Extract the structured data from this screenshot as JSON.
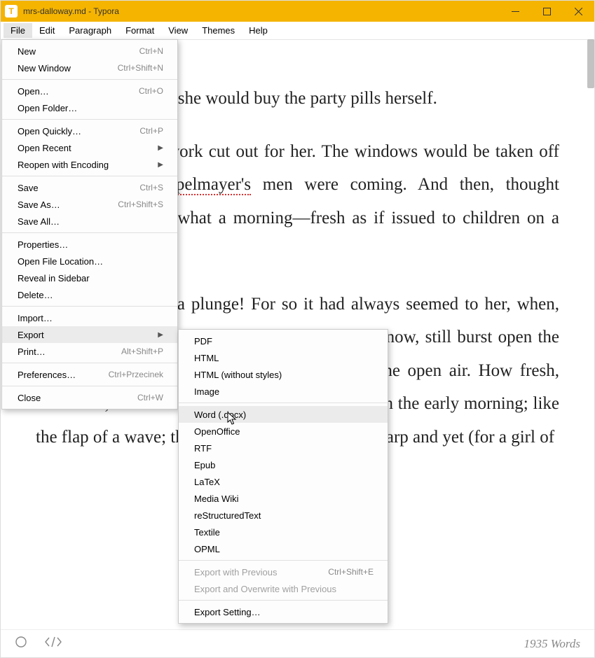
{
  "titlebar": {
    "icon_letter": "T",
    "title": "mrs-dalloway.md - Typora"
  },
  "menubar": {
    "items": [
      "File",
      "Edit",
      "Paragraph",
      "Format",
      "View",
      "Themes",
      "Help"
    ]
  },
  "file_menu": {
    "items": [
      {
        "label": "New",
        "short": "Ctrl+N"
      },
      {
        "label": "New Window",
        "short": "Ctrl+Shift+N"
      },
      {
        "sep": true
      },
      {
        "label": "Open…",
        "short": "Ctrl+O"
      },
      {
        "label": "Open Folder…"
      },
      {
        "sep": true
      },
      {
        "label": "Open Quickly…",
        "short": "Ctrl+P"
      },
      {
        "label": "Open Recent",
        "submenu": true
      },
      {
        "label": "Reopen with Encoding",
        "submenu": true
      },
      {
        "sep": true
      },
      {
        "label": "Save",
        "short": "Ctrl+S"
      },
      {
        "label": "Save As…",
        "short": "Ctrl+Shift+S"
      },
      {
        "label": "Save All…"
      },
      {
        "sep": true
      },
      {
        "label": "Properties…"
      },
      {
        "label": "Open File Location…"
      },
      {
        "label": "Reveal in Sidebar"
      },
      {
        "label": "Delete…"
      },
      {
        "sep": true
      },
      {
        "label": "Import…"
      },
      {
        "label": "Export",
        "submenu": true,
        "highlight": true
      },
      {
        "label": "Print…",
        "short": "Alt+Shift+P"
      },
      {
        "sep": true
      },
      {
        "label": "Preferences…",
        "short": "Ctrl+Przecinek"
      },
      {
        "sep": true
      },
      {
        "label": "Close",
        "short": "Ctrl+W"
      }
    ]
  },
  "export_menu": {
    "items": [
      {
        "label": "PDF"
      },
      {
        "label": "HTML"
      },
      {
        "label": "HTML (without styles)"
      },
      {
        "label": "Image"
      },
      {
        "sep": true
      },
      {
        "label": "Word (.docx)",
        "highlight": true
      },
      {
        "label": "OpenOffice"
      },
      {
        "label": "RTF"
      },
      {
        "label": "Epub"
      },
      {
        "label": "LaTeX"
      },
      {
        "label": "Media Wiki"
      },
      {
        "label": "reStructuredText"
      },
      {
        "label": "Textile"
      },
      {
        "label": "OPML"
      },
      {
        "sep": true
      },
      {
        "label": "Export with Previous",
        "short": "Ctrl+Shift+E",
        "disabled": true
      },
      {
        "label": "Export and Overwrite with Previous",
        "disabled": true
      },
      {
        "sep": true
      },
      {
        "label": "Export Setting…"
      }
    ]
  },
  "document": {
    "p1a": "Mrs. Dalloway said she would buy the party pills herself.",
    "p2a": "For Lucy had her work cut out for her. The windows would be taken off their hinges; ",
    "p2b": "Rumpelmayer's",
    "p2c": " men were coming. And then, thought Clarissa Dalloway, what a morning—fresh as if issued to children on a beach.",
    "p3": "What a lark! What a plunge! For so it had always seemed to her, when, with a little of the hinges, which she could hear now, still burst open the French windows and plunged at Bourton into the open air. How fresh, how calm, stiller than this of course, the air was in the early morning; like the flap of a wave; the kiss of a wave; chill and sharp and yet (for a girl of"
  },
  "statusbar": {
    "words": "1935 Words"
  }
}
